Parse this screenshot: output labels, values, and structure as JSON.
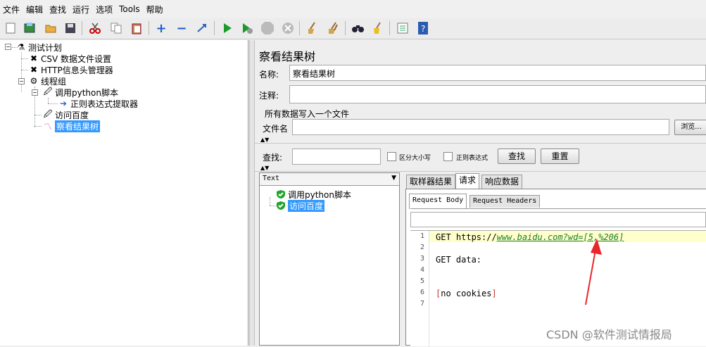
{
  "menu": [
    "文件",
    "编辑",
    "查找",
    "运行",
    "选项",
    "Tools",
    "帮助"
  ],
  "tree": {
    "root": "测试计划",
    "csv": "CSV 数据文件设置",
    "header": "HTTP信息头管理器",
    "threadgroup": "线程组",
    "python": "调用python脚本",
    "regex": "正则表达式提取器",
    "baidu": "访问百度",
    "viewtree": "察看结果树"
  },
  "panel": {
    "title": "察看结果树",
    "name_label": "名称:",
    "name_value": "察看结果树",
    "comment_label": "注释:",
    "comment_value": "",
    "write_all": "所有数据写入一个文件",
    "filename_label": "文件名",
    "filename_value": "",
    "browse": "浏览...",
    "search_label": "查找:",
    "search_value": "",
    "case_label": "区分大小写",
    "regex_label": "正则表达式",
    "find_btn": "查找",
    "reset_btn": "重置"
  },
  "results": {
    "render_mode": "Text",
    "items": [
      "调用python脚本",
      "访问百度"
    ],
    "tabs": [
      "取样器结果",
      "请求",
      "响应数据"
    ],
    "subtabs": [
      "Request Body",
      "Request Headers"
    ],
    "search_value": "",
    "lines": [
      {
        "n": "1",
        "text": "GET https://",
        "link": "www.baidu.com?wd=[5,%206]"
      },
      {
        "n": "2",
        "text": ""
      },
      {
        "n": "3",
        "text": "GET data:"
      },
      {
        "n": "4",
        "text": ""
      },
      {
        "n": "5",
        "text": ""
      },
      {
        "n": "6",
        "text": "[no cookies]"
      },
      {
        "n": "7",
        "text": ""
      }
    ]
  },
  "watermark": "CSDN @软件测试情报局",
  "colors": {
    "selection": "#3399ff",
    "highlight_line": "#ffffcc",
    "arrow": "#e8262b",
    "link": "#1a7d2a"
  }
}
